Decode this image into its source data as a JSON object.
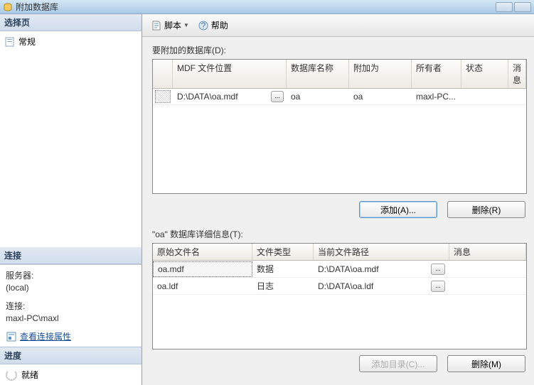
{
  "titlebar": {
    "title": "附加数据库"
  },
  "sidebar": {
    "section_select": "选择页",
    "general": "常规",
    "section_connection": "连接",
    "server_label": "服务器:",
    "server_value": "(local)",
    "connection_label": "连接:",
    "connection_value": "maxl-PC\\maxl",
    "view_props_link": "查看连接属性",
    "section_progress": "进度",
    "progress_status": "就绪"
  },
  "toolbar": {
    "script_label": "脚本",
    "help_label": "帮助"
  },
  "content": {
    "attach_label": "要附加的数据库(D):",
    "attach_table": {
      "headers": {
        "mdf": "MDF 文件位置",
        "dbname": "数据库名称",
        "attachas": "附加为",
        "owner": "所有者",
        "status": "状态",
        "message": "消息"
      },
      "rows": [
        {
          "path": "D:\\DATA\\oa.mdf",
          "dbname": "oa",
          "attachas": "oa",
          "owner": "maxl-PC...",
          "status": "",
          "message": ""
        }
      ]
    },
    "add_button": "添加(A)...",
    "remove_button": "删除(R)",
    "details_label": "\"oa\" 数据库详细信息(T):",
    "details_table": {
      "headers": {
        "original": "原始文件名",
        "filetype": "文件类型",
        "currentpath": "当前文件路径",
        "message": "消息"
      },
      "rows": [
        {
          "original": "oa.mdf",
          "filetype": "数据",
          "currentpath": "D:\\DATA\\oa.mdf",
          "message": ""
        },
        {
          "original": "oa.ldf",
          "filetype": "日志",
          "currentpath": "D:\\DATA\\oa.ldf",
          "message": ""
        }
      ]
    },
    "add_catalog_button": "添加目录(C)...",
    "delete_m_button": "删除(M)"
  }
}
